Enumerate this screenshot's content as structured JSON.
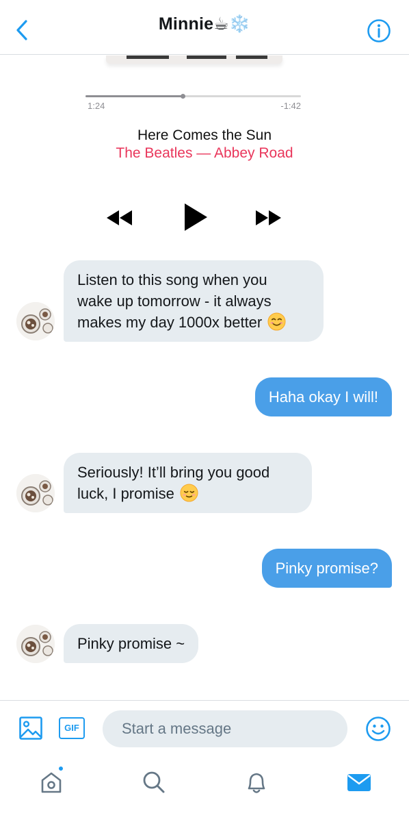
{
  "header": {
    "title": "Minnie☕❄️",
    "back_icon": "chevron-left-icon",
    "info_icon": "info-icon",
    "accent_color": "#1d9bf0"
  },
  "player": {
    "elapsed": "1:24",
    "remaining": "-1:42",
    "progress": 0.45,
    "song": "Here Comes the Sun",
    "artist_album": "The Beatles — Abbey Road",
    "artist_color": "#e9365b",
    "controls": [
      "rewind-icon",
      "play-icon",
      "fast-forward-icon"
    ]
  },
  "messages": [
    {
      "from": "Minnie",
      "direction": "incoming",
      "lines": [
        "Listen to this song when you",
        "wake up tomorrow - it always",
        "makes my day 1000x better"
      ],
      "emoji": "smiling-face-icon"
    },
    {
      "direction": "outgoing",
      "text": "Haha okay I will!"
    },
    {
      "from": "Minnie",
      "direction": "incoming",
      "lines": [
        "Seriously! It’ll bring you good",
        "luck, I promise"
      ],
      "emoji": "relieved-face-icon"
    },
    {
      "direction": "outgoing",
      "text": "Pinky promise?"
    },
    {
      "from": "Minnie",
      "direction": "incoming",
      "lines": [
        "Pinky promise ~"
      ]
    }
  ],
  "composer": {
    "placeholder": "Start a message",
    "gif_label": "GIF"
  },
  "tabbar": {
    "items": [
      "home-icon",
      "search-icon",
      "notifications-icon",
      "messages-icon"
    ],
    "active": "messages-icon"
  }
}
